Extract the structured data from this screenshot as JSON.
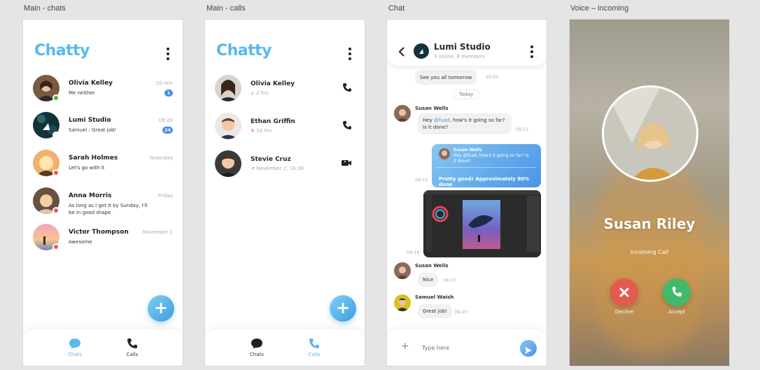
{
  "labels": {
    "chats_frame": "Main - chats",
    "calls_frame": "Main - calls",
    "chat_frame": "Chat",
    "incoming_frame": "Voice – incoming"
  },
  "app_name": "Chatty",
  "chats": [
    {
      "name": "Olivia Kelley",
      "message": "Me neither",
      "time": "10 min",
      "badge": "1",
      "status": "#4caf50"
    },
    {
      "name": "Lumi Studio",
      "message": "Samuel : Great job!",
      "time": "09:20",
      "badge": "24",
      "status": ""
    },
    {
      "name": "Sarah Holmes",
      "message": "Let's go with it",
      "time": "Yesterday",
      "badge": "",
      "status": "#e85a5a"
    },
    {
      "name": "Anna Morris",
      "message": "As long as I get it by Sunday, I'll be in good shape",
      "time": "Friday",
      "badge": "",
      "status": "#e85a5a"
    },
    {
      "name": "Victor Thompson",
      "message": "Awesome",
      "time": "November 1",
      "badge": "",
      "status": "#e85a5a"
    }
  ],
  "calls": [
    {
      "name": "Olivia Kelley",
      "sub": "2 hrs",
      "direction": "incoming",
      "type": "phone-icon"
    },
    {
      "name": "Ethan Griffin",
      "sub": "10 hrs",
      "direction": "missed",
      "type": "phone-icon"
    },
    {
      "name": "Stevie Cruz",
      "sub": "November 2, 16:38",
      "direction": "outgoing",
      "type": "video-icon"
    }
  ],
  "tabs": {
    "chats": "Chats",
    "calls": "Calls"
  },
  "chat": {
    "title": "Lumi Studio",
    "subtitle": "3 online, 8 members",
    "msg1": "See you all tomorrow",
    "msg1_time": "20:55",
    "divider": "Today",
    "sender1": "Susan Wells",
    "msg2_pre": "Hey ",
    "msg2_mention": "@fuad",
    "msg2_post": ", how's it going so far? Is it done?",
    "msg2_time": "09:11",
    "reply_quote_name": "Susan Wells",
    "reply_quote_text": "Hey @fuad, how's it going so far? Is it done?",
    "reply_text": "Pretty good! Approximately 80% done",
    "reply_time": "09:15",
    "image_time": "09:16",
    "sender2": "Susan Wells",
    "msg3": "Nice",
    "msg3_time": "09:17",
    "sender3": "Samuel Waish",
    "msg4": "Great job!",
    "msg4_time": "09:20",
    "input_placeholder": "Type here"
  },
  "incoming": {
    "name": "Susan Riley",
    "status": "Incoming Call",
    "decline": "Decline",
    "accept": "Accept"
  },
  "colors": {
    "accent": "#5bb8ee",
    "badge": "#4a8de0",
    "decline": "#e55a4f",
    "accept": "#43b96b"
  }
}
